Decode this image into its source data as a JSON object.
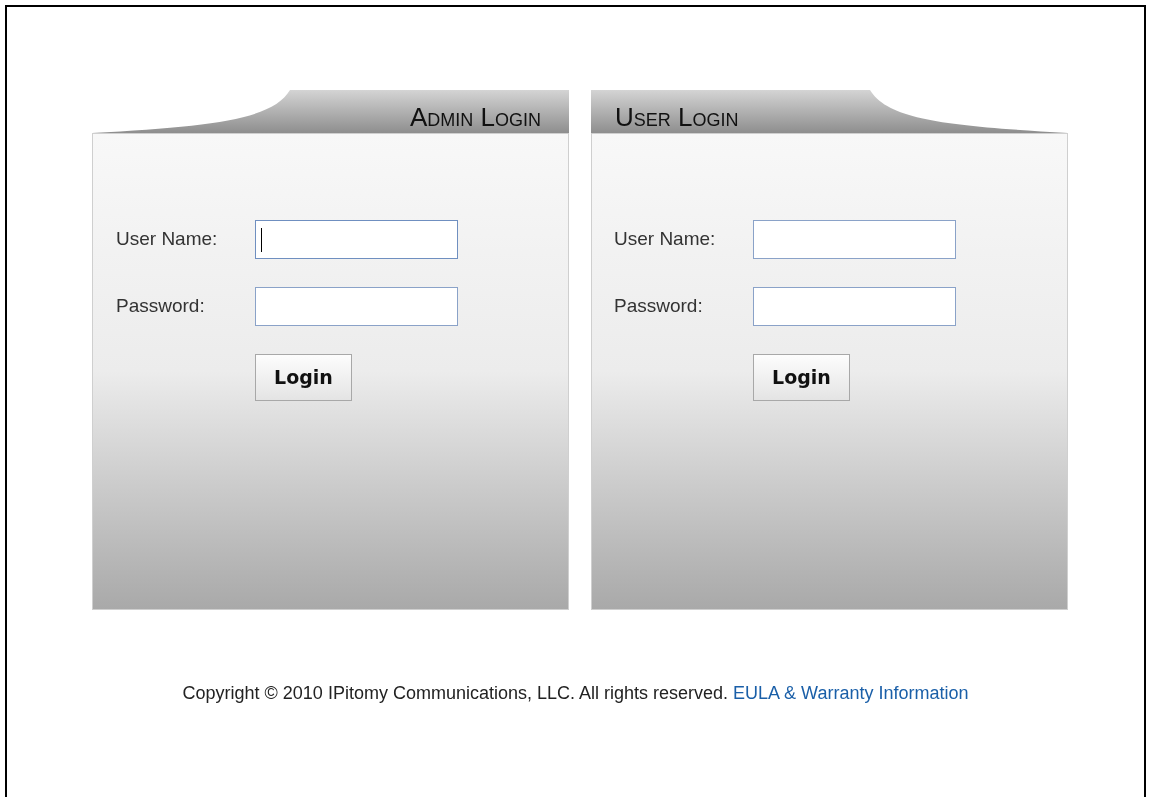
{
  "panels": [
    {
      "title": "Admin Login",
      "fields": [
        {
          "label": "User Name:",
          "focused": true
        },
        {
          "label": "Password:",
          "focused": false
        }
      ],
      "button": "Login"
    },
    {
      "title": "User Login",
      "fields": [
        {
          "label": "User Name:",
          "focused": false
        },
        {
          "label": "Password:",
          "focused": false
        }
      ],
      "button": "Login"
    }
  ],
  "footer": {
    "copyright": "Copyright © 2010 IPitomy Communications, LLC. All rights reserved.",
    "link": "EULA & Warranty Information"
  }
}
